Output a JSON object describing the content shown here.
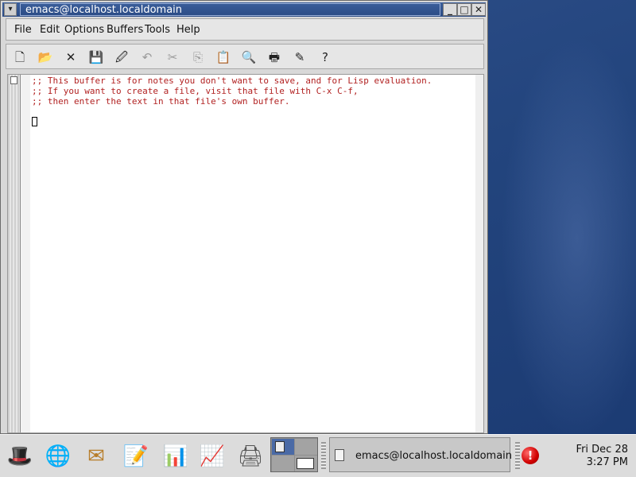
{
  "window": {
    "title": "emacs@localhost.localdomain",
    "buttons": {
      "minimize": "_",
      "maximize": "□",
      "close": "✕"
    }
  },
  "menubar": {
    "items": [
      "File",
      "Edit",
      "Options",
      "Buffers",
      "Tools",
      "Help"
    ]
  },
  "toolbar": {
    "tools": [
      {
        "name": "new-file-icon",
        "glyph": "🗋",
        "enabled": true
      },
      {
        "name": "open-folder-icon",
        "glyph": "📂",
        "enabled": true
      },
      {
        "name": "close-x-icon",
        "glyph": "✕",
        "enabled": true
      },
      {
        "name": "save-disk-icon",
        "glyph": "💾",
        "enabled": false
      },
      {
        "name": "save-as-icon",
        "glyph": "🖉",
        "enabled": true
      },
      {
        "name": "undo-icon",
        "glyph": "↶",
        "enabled": false
      },
      {
        "name": "cut-scissors-icon",
        "glyph": "✂",
        "enabled": false
      },
      {
        "name": "copy-icon",
        "glyph": "⎘",
        "enabled": false
      },
      {
        "name": "paste-icon",
        "glyph": "📋",
        "enabled": false
      },
      {
        "name": "search-icon",
        "glyph": "🔍",
        "enabled": true
      },
      {
        "name": "print-icon",
        "glyph": "🖶",
        "enabled": true
      },
      {
        "name": "preferences-icon",
        "glyph": "✎",
        "enabled": true
      },
      {
        "name": "help-icon",
        "glyph": "?",
        "enabled": true
      }
    ]
  },
  "buffer": {
    "lines": [
      ";; This buffer is for notes you don't want to save, and for Lisp evaluation.",
      ";; If you want to create a file, visit that file with C-x C-f,",
      ";; then enter the text in that file's own buffer."
    ],
    "text_color": "#b22222"
  },
  "panel": {
    "taskbar_item": "emacs@localhost.localdomain",
    "alert_glyph": "!",
    "clock": {
      "date": "Fri Dec 28",
      "time": "3:27 PM"
    }
  }
}
